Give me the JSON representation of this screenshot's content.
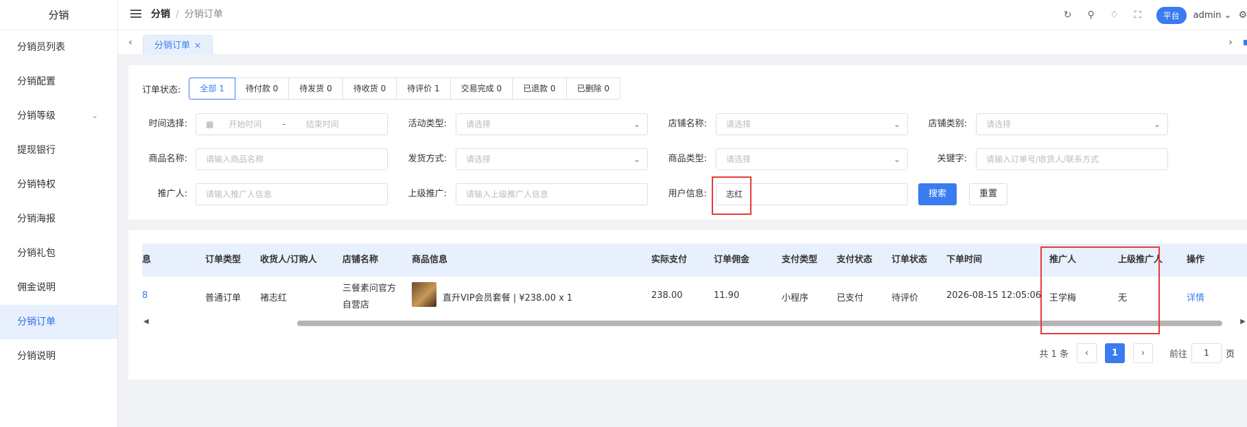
{
  "sidebar": {
    "title": "分销",
    "items": [
      {
        "label": "分销员列表"
      },
      {
        "label": "分销配置"
      },
      {
        "label": "分销等级"
      },
      {
        "label": "提现银行"
      },
      {
        "label": "分销特权"
      },
      {
        "label": "分销海报"
      },
      {
        "label": "分销礼包"
      },
      {
        "label": "佣金说明"
      },
      {
        "label": "分销订单"
      },
      {
        "label": "分销说明"
      }
    ],
    "active_index": 8
  },
  "header": {
    "breadcrumb": [
      "分销",
      "分销订单"
    ],
    "platform_label": "平台",
    "user_name": "admin"
  },
  "tabs": [
    {
      "label": "分销订单"
    }
  ],
  "filters": {
    "status_label": "订单状态:",
    "status_options": [
      "全部 1",
      "待付款 0",
      "待发货 0",
      "待收货 0",
      "待评价 1",
      "交易完成 0",
      "已退款 0",
      "已删除 0"
    ],
    "time_label": "时间选择:",
    "time_start_placeholder": "开始时间",
    "time_sep": "-",
    "time_end_placeholder": "结束时间",
    "activity_label": "活动类型:",
    "activity_placeholder": "请选择",
    "shop_name_label": "店铺名称:",
    "shop_name_placeholder": "请选择",
    "shop_cat_label": "店铺类别:",
    "shop_cat_placeholder": "请选择",
    "product_name_label": "商品名称:",
    "product_name_placeholder": "请输入商品名称",
    "ship_label": "发货方式:",
    "ship_placeholder": "请选择",
    "product_type_label": "商品类型:",
    "product_type_placeholder": "请选择",
    "keyword_label": "关键字:",
    "keyword_placeholder": "请输入订单号/收货人/联系方式",
    "promoter_label": "推广人:",
    "promoter_placeholder": "请输入推广人信息",
    "upper_label": "上级推广:",
    "upper_placeholder": "请输入上级推广人信息",
    "user_info_label": "用户信息:",
    "user_info_value": "志红",
    "search_label": "搜索",
    "reset_label": "重置"
  },
  "table": {
    "columns": [
      "息",
      "订单类型",
      "收货人/订购人",
      "店铺名称",
      "商品信息",
      "实际支付",
      "订单佣金",
      "支付类型",
      "支付状态",
      "订单状态",
      "下单时间",
      "推广人",
      "上级推广人",
      "操作"
    ],
    "rows": [
      {
        "first": "8",
        "order_type": "普通订单",
        "receiver": "褚志红",
        "shop_line1": "三餐素问官方",
        "shop_line2": "自营店",
        "product": "直升VIP会员套餐 | ¥238.00 x 1",
        "paid": "238.00",
        "commission": "11.90",
        "pay_type": "小程序",
        "pay_status": "已支付",
        "order_status": "待评价",
        "order_time": "2026-08-15 12:05:06",
        "promoter": "王学梅",
        "upper_promoter": "无",
        "action": "详情"
      }
    ]
  },
  "pagination": {
    "total_text": "共 1 条",
    "current_page": "1",
    "goto_label": "前往",
    "goto_value": "1",
    "page_unit": "页"
  },
  "colors": {
    "accent": "#3a7bf0",
    "highlight": "#e53935"
  }
}
